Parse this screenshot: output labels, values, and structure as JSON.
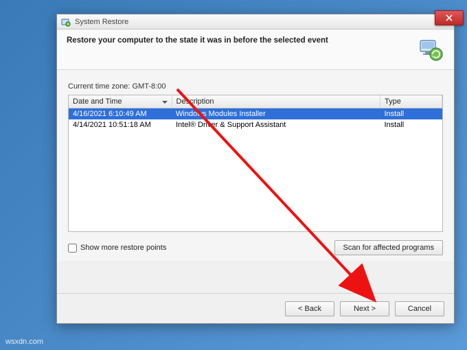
{
  "window": {
    "title": "System Restore"
  },
  "header": {
    "heading": "Restore your computer to the state it was in before the selected event"
  },
  "timezone_label": "Current time zone: GMT-8:00",
  "table": {
    "columns": {
      "datetime": "Date and Time",
      "description": "Description",
      "type": "Type"
    },
    "rows": [
      {
        "datetime": "4/16/2021 6:10:49 AM",
        "description": "Windows Modules Installer",
        "type": "Install",
        "selected": true
      },
      {
        "datetime": "4/14/2021 10:51:18 AM",
        "description": "Intel® Driver & Support Assistant",
        "type": "Install",
        "selected": false
      }
    ]
  },
  "show_more_label": "Show more restore points",
  "buttons": {
    "scan": "Scan for affected programs",
    "back": "< Back",
    "next": "Next >",
    "cancel": "Cancel"
  },
  "watermark": "wsxdn.com"
}
